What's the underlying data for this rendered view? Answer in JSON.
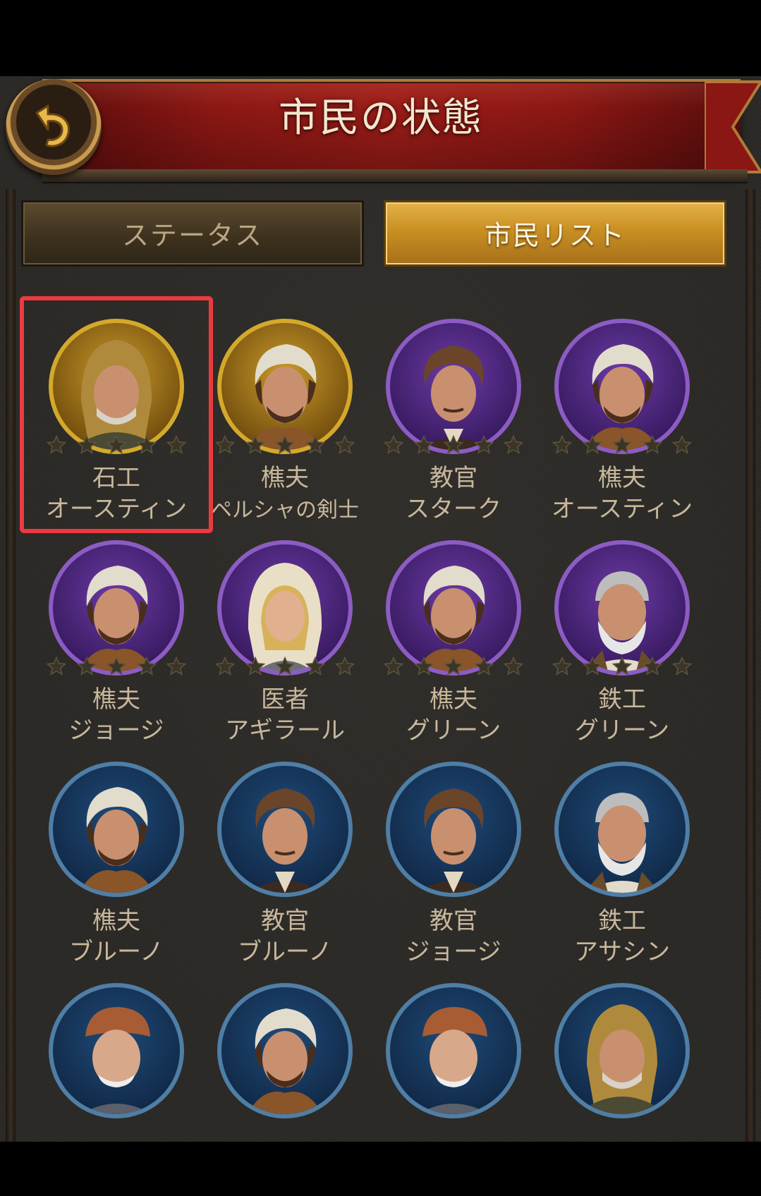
{
  "header": {
    "title": "市民の状態"
  },
  "tabs": [
    {
      "label": "ステータス",
      "active": false
    },
    {
      "label": "市民リスト",
      "active": true
    }
  ],
  "citizens": [
    {
      "job": "石工",
      "name": "オースティン",
      "frame": "gold",
      "icon": "hooded-man-portrait",
      "selected": true
    },
    {
      "job": "樵夫",
      "name": "ペルシャの剣士",
      "frame": "gold",
      "icon": "young-man-headscarf-portrait"
    },
    {
      "job": "教官",
      "name": "スターク",
      "frame": "purple",
      "icon": "curly-hair-man-portrait"
    },
    {
      "job": "樵夫",
      "name": "オースティン",
      "frame": "purple",
      "icon": "young-man-headscarf-portrait"
    },
    {
      "job": "樵夫",
      "name": "ジョージ",
      "frame": "purple",
      "icon": "young-man-headscarf-portrait"
    },
    {
      "job": "医者",
      "name": "アギラール",
      "frame": "purple",
      "icon": "woman-bonnet-portrait"
    },
    {
      "job": "樵夫",
      "name": "グリーン",
      "frame": "purple",
      "icon": "young-man-headscarf-portrait"
    },
    {
      "job": "鉄工",
      "name": "グリーン",
      "frame": "purple",
      "icon": "old-bearded-man-portrait"
    },
    {
      "job": "樵夫",
      "name": "ブルーノ",
      "frame": "blue",
      "icon": "young-man-headscarf-portrait"
    },
    {
      "job": "教官",
      "name": "ブルーノ",
      "frame": "blue",
      "icon": "curly-hair-man-portrait"
    },
    {
      "job": "教官",
      "name": "ジョージ",
      "frame": "blue",
      "icon": "curly-hair-man-portrait"
    },
    {
      "job": "鉄工",
      "name": "アサシン",
      "frame": "blue",
      "icon": "old-bearded-man-portrait"
    },
    {
      "job": "",
      "name": "",
      "frame": "blue",
      "icon": "old-man-cap-portrait"
    },
    {
      "job": "",
      "name": "",
      "frame": "blue",
      "icon": "young-man-headscarf-portrait"
    },
    {
      "job": "",
      "name": "",
      "frame": "blue",
      "icon": "old-man-cap-portrait"
    },
    {
      "job": "",
      "name": "",
      "frame": "blue",
      "icon": "hooded-man-portrait"
    }
  ],
  "icons": {
    "back": "back-arrow-icon",
    "star": "star-icon"
  },
  "colors": {
    "gold": "#d4a92b",
    "purple": "#8c5cc4",
    "blue": "#4f7ea6",
    "highlight": "#ec3a3f"
  }
}
